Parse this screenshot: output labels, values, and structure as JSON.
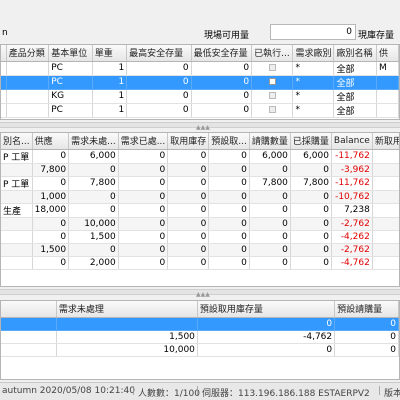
{
  "top": {
    "left_label": "n",
    "qty_label": "現場可用量",
    "qty_value": "0",
    "stock_label": "現庫存量"
  },
  "grid1": {
    "headers": [
      "",
      "產品分類",
      "基本單位",
      "單重",
      "最高安全存量",
      "最低安全存量",
      "已執行...",
      "需求廠別",
      "廠別名稱",
      "供"
    ],
    "rows": [
      {
        "cells": [
          "",
          "",
          "PC",
          "1",
          "0",
          "0",
          "",
          "*",
          "全部",
          "M"
        ],
        "checked": false,
        "selected": false
      },
      {
        "cells": [
          "",
          "",
          "PC",
          "1",
          "0",
          "0",
          "",
          "*",
          "全部",
          ""
        ],
        "checked": true,
        "selected": true
      },
      {
        "cells": [
          "",
          "",
          "KG",
          "1",
          "0",
          "0",
          "",
          "*",
          "全部",
          ""
        ],
        "checked": false,
        "selected": false
      },
      {
        "cells": [
          "",
          "",
          "PC",
          "1",
          "0",
          "0",
          "",
          "*",
          "全部",
          ""
        ],
        "checked": false,
        "selected": false
      }
    ]
  },
  "grid2": {
    "headers": [
      "別名...",
      "供應",
      "需求未處...",
      "需求已處...",
      "取用庫存",
      "預設取...",
      "請購數量",
      "已採購量",
      "Balance",
      "新取用..."
    ],
    "rows": [
      [
        "P 工單",
        "0",
        "6,000",
        "0",
        "0",
        "0",
        "6,000",
        "6,000",
        "-11,762",
        "0"
      ],
      [
        "",
        "7,800",
        "0",
        "0",
        "0",
        "0",
        "0",
        "0",
        "-3,962",
        "0"
      ],
      [
        "P 工單",
        "0",
        "7,800",
        "0",
        "0",
        "0",
        "7,800",
        "7,800",
        "-11,762",
        "0"
      ],
      [
        "",
        "1,000",
        "0",
        "0",
        "0",
        "0",
        "0",
        "0",
        "-10,762",
        "0"
      ],
      [
        "生產",
        "18,000",
        "0",
        "0",
        "0",
        "0",
        "0",
        "0",
        "7,238",
        "0"
      ],
      [
        "",
        "0",
        "10,000",
        "0",
        "0",
        "0",
        "0",
        "0",
        "-2,762",
        "0"
      ],
      [
        "",
        "0",
        "1,500",
        "0",
        "0",
        "0",
        "0",
        "0",
        "-4,262",
        "0"
      ],
      [
        "",
        "1,500",
        "0",
        "0",
        "0",
        "0",
        "0",
        "0",
        "-2,762",
        "0"
      ],
      [
        "",
        "0",
        "2,000",
        "0",
        "0",
        "0",
        "0",
        "0",
        "-4,762",
        "0"
      ]
    ]
  },
  "grid3": {
    "headers": [
      "",
      "需求未處理",
      "預設取用庫存量",
      "預設請購量"
    ],
    "rows": [
      {
        "cells": [
          "",
          "",
          "0",
          "0"
        ],
        "selected": true
      },
      {
        "cells": [
          "",
          "1,500",
          "-4,762",
          "0"
        ],
        "selected": false
      },
      {
        "cells": [
          "",
          "10,000",
          "0",
          "0"
        ],
        "selected": false
      }
    ]
  },
  "status": {
    "user": "autumn 2020/05/08 10:21:40",
    "users": "人數數：1/100",
    "server": "伺服器：113.196.186.188 ESTAERPV2",
    "version": "版本"
  }
}
